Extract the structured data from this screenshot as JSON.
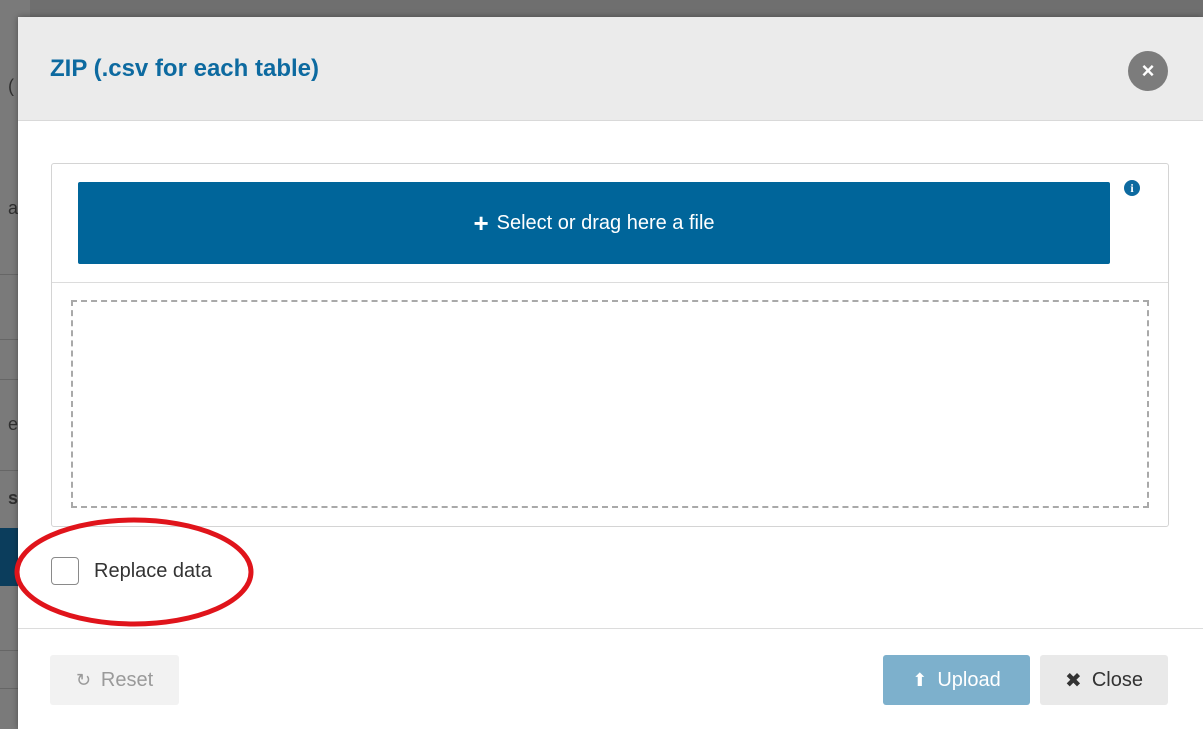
{
  "background": {
    "glyphs": [
      "(",
      "a",
      "e",
      "s"
    ]
  },
  "modal": {
    "title": "ZIP (.csv for each table)",
    "close_icon": "×",
    "select_file": {
      "icon": "+",
      "label": "Select or drag here a file"
    },
    "info_icon": "i",
    "replace_data": {
      "label": "Replace data",
      "checked": false
    },
    "buttons": {
      "reset": {
        "icon": "↻",
        "label": "Reset",
        "enabled": false
      },
      "upload": {
        "icon": "⬆",
        "label": "Upload",
        "enabled": false
      },
      "close": {
        "icon": "✖",
        "label": "Close"
      }
    }
  },
  "colors": {
    "title": "#0d6aa0",
    "primary_button": "#00659a",
    "upload_disabled": "#7db0cc",
    "annotation": "#e0141b"
  }
}
